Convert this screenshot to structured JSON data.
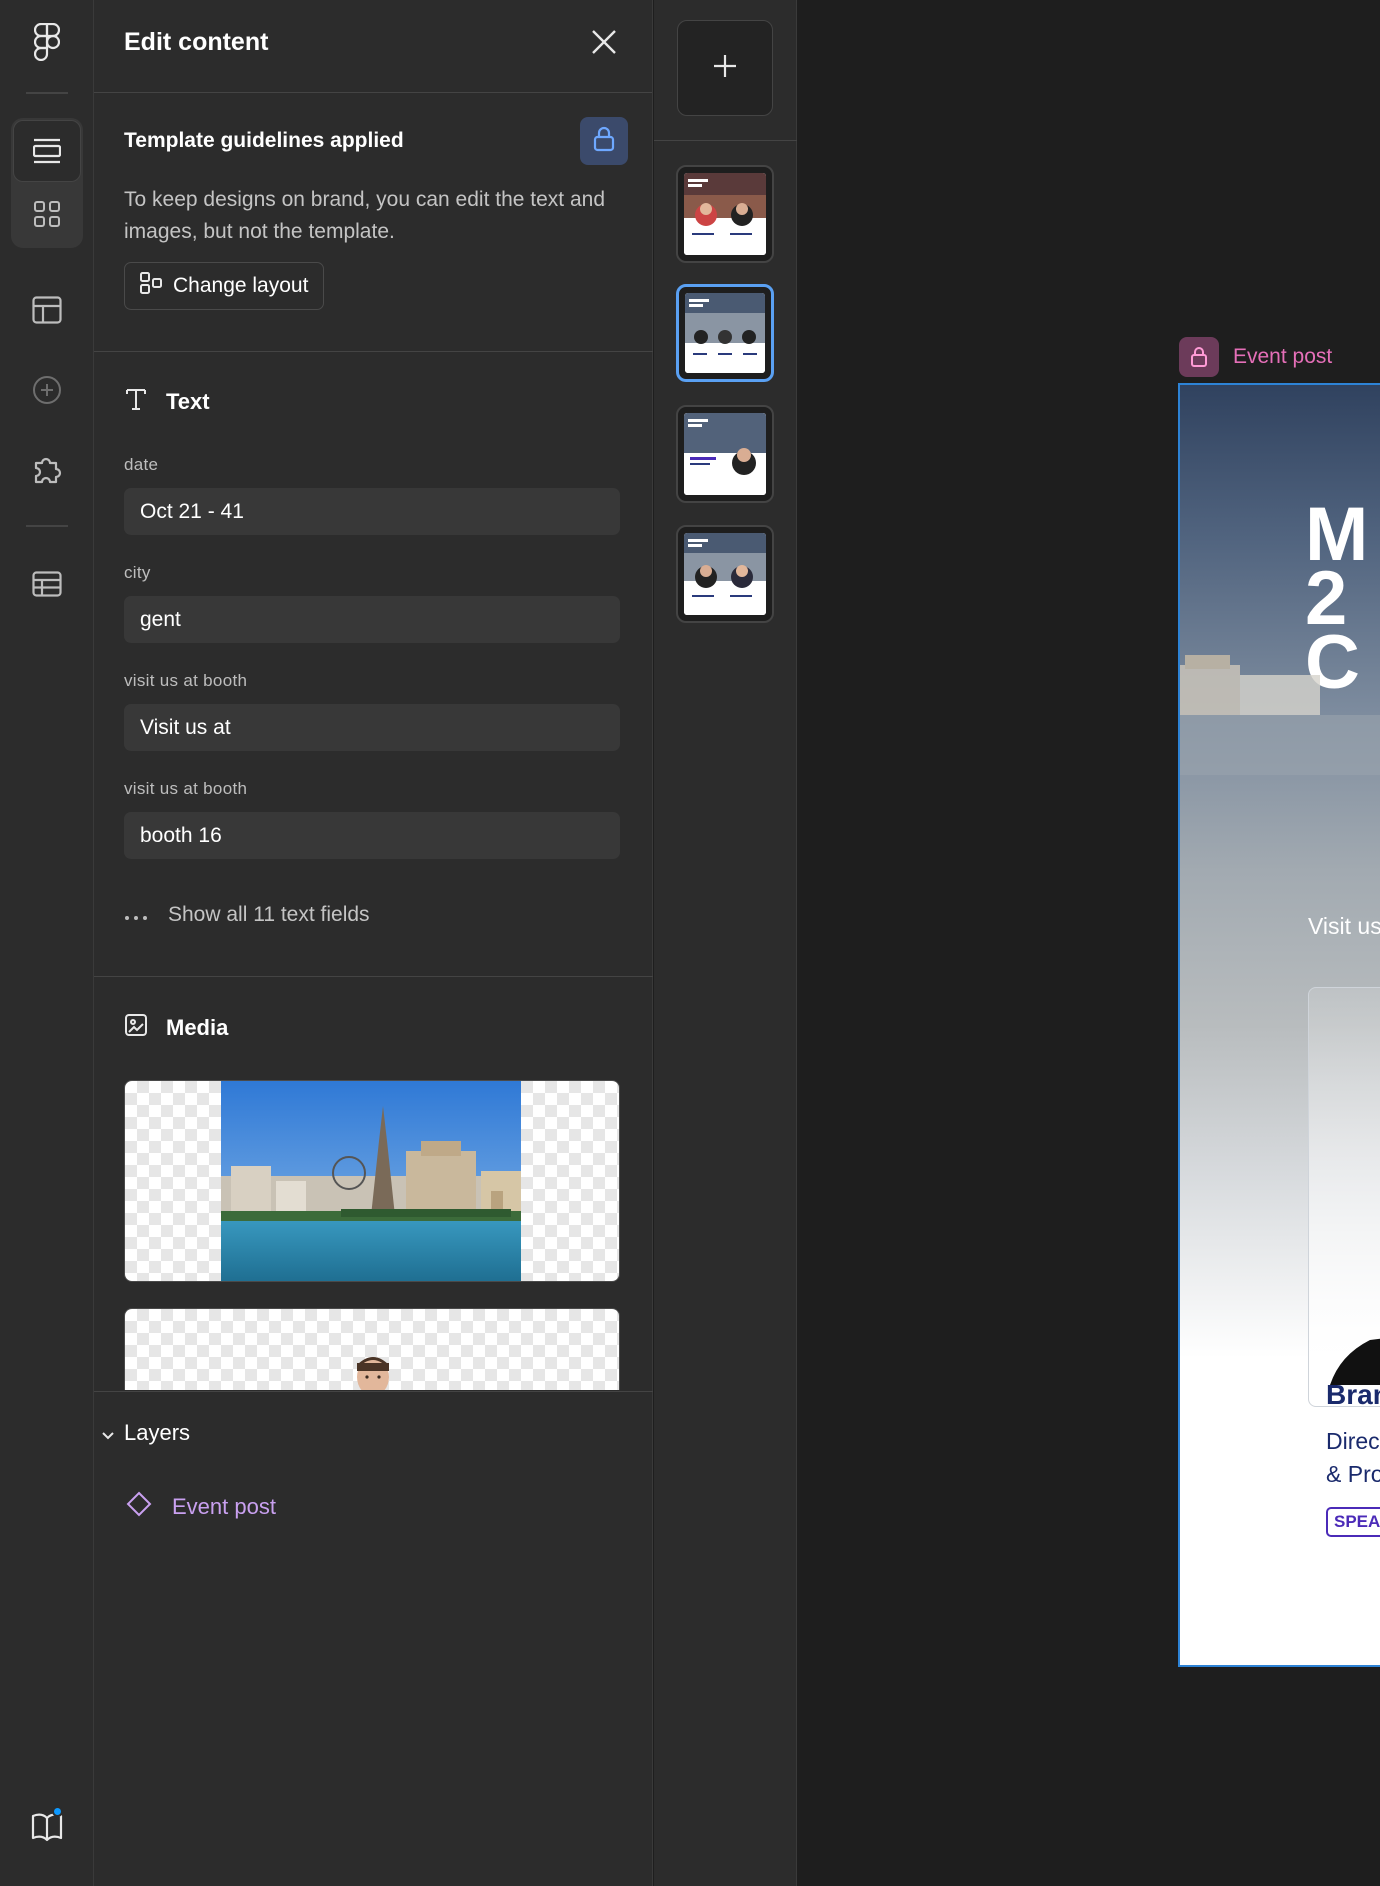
{
  "panel": {
    "title": "Edit content",
    "guidelines": {
      "title": "Template guidelines applied",
      "description": "To keep designs on brand, you can edit the text and images, but not the template.",
      "change_layout_label": "Change layout"
    },
    "text_section": {
      "title": "Text",
      "fields": [
        {
          "label": "date",
          "value": "Oct 21 - 41"
        },
        {
          "label": "city",
          "value": "gent"
        },
        {
          "label": "visit us at booth",
          "value": "Visit us at"
        },
        {
          "label": "visit us at booth",
          "value": "booth 16"
        }
      ],
      "show_all_label": "Show all 11 text fields"
    },
    "media_section": {
      "title": "Media"
    },
    "layers": {
      "title": "Layers",
      "items": [
        {
          "label": "Event post"
        }
      ]
    }
  },
  "canvas": {
    "frame_label": "Event post",
    "frame_content": {
      "logo_text": "M 2C",
      "visit_text": "Visit us",
      "speaker_name": "Bran",
      "speaker_role_line1": "Direc",
      "speaker_role_line2": "& Pro",
      "speaker_badge": "SPEA"
    }
  },
  "colors": {
    "accent_blue": "#5aa0f2",
    "frame_border": "#2d83d6",
    "layer_purple": "#c9a0f0",
    "frame_label_pink": "#e56fb8",
    "notification": "#0d99ff"
  },
  "icons": [
    "figma-logo-icon",
    "layers-icon",
    "assets-icon",
    "layout-icon",
    "add-circle-icon",
    "plugin-icon",
    "table-icon",
    "book-icon",
    "close-icon",
    "lock-icon",
    "change-layout-icon",
    "text-icon",
    "more-icon",
    "image-icon",
    "chevron-down-icon",
    "component-icon",
    "plus-icon"
  ]
}
